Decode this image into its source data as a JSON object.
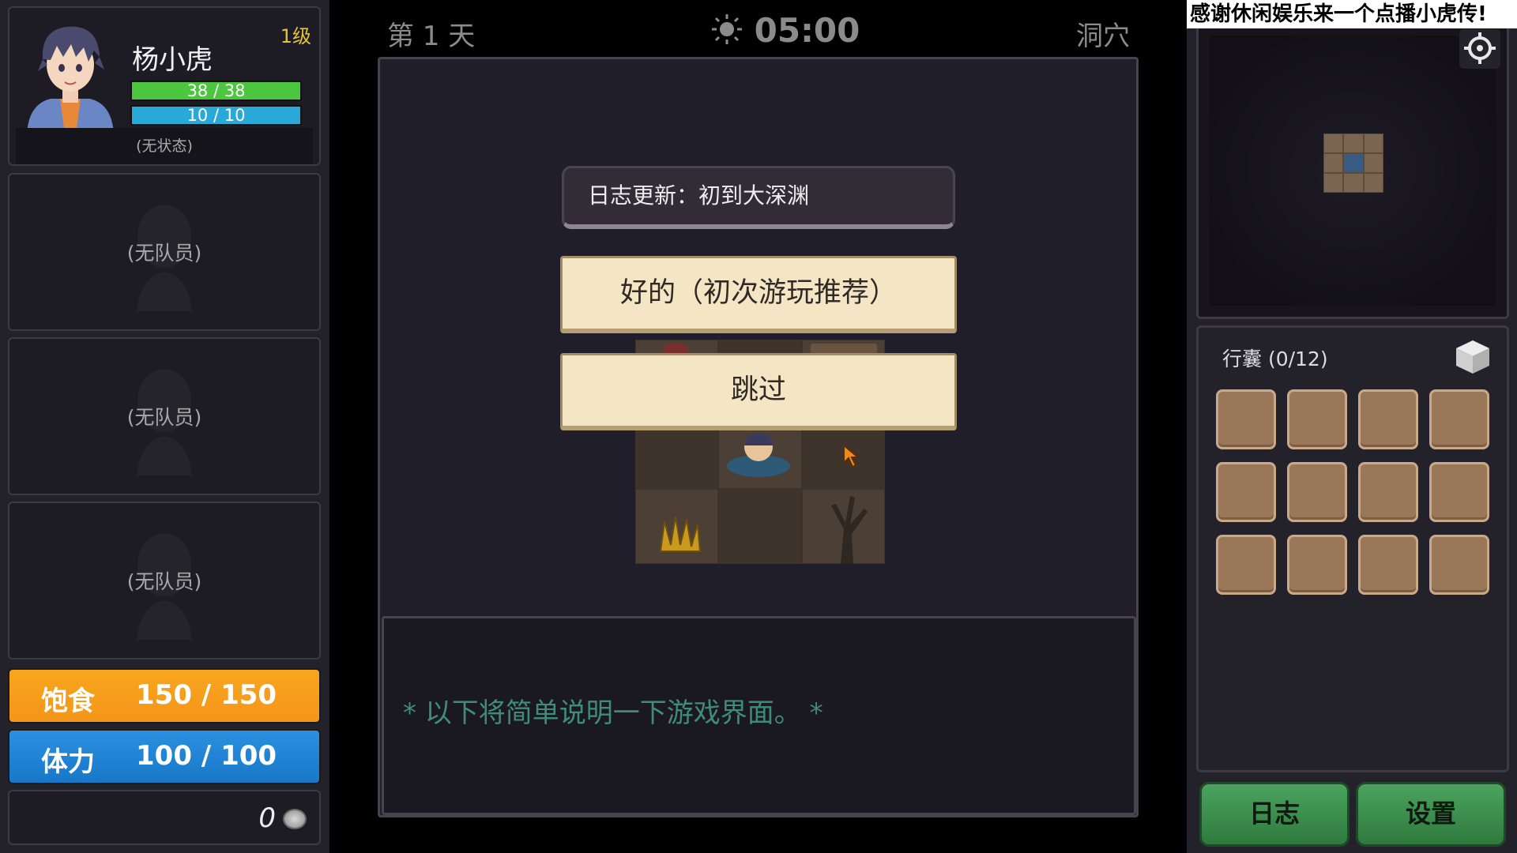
{
  "hero": {
    "name": "杨小虎",
    "level": "1级",
    "hp": "38 / 38",
    "mp": "10 / 10",
    "status": "(无状态)"
  },
  "party": [
    {
      "label": "(无队员)"
    },
    {
      "label": "(无队员)"
    },
    {
      "label": "(无队员)"
    }
  ],
  "stats": {
    "food_label": "饱食",
    "food_value": "150 / 150",
    "stamina_label": "体力",
    "stamina_value": "100 / 100",
    "coins": "0"
  },
  "topbar": {
    "day": "第 1 天",
    "time": "05:00",
    "location": "洞穴"
  },
  "dialog": {
    "title": "日志更新：初到大深渊",
    "ok_button": "好的（初次游玩推荐）",
    "skip_button": "跳过"
  },
  "log": {
    "message": "* 以下将简单说明一下游戏界面。 *"
  },
  "banner": {
    "text": "感谢休闲娱乐来一个点播小虎传!"
  },
  "inventory": {
    "title": "行囊 (0/12)",
    "slots": 12
  },
  "footer": {
    "log_button": "日志",
    "settings_button": "设置"
  },
  "colors": {
    "hp": "#4cc63f",
    "mp": "#29a9d8",
    "food": "#f4951a",
    "stamina": "#1778c8",
    "button_green": "#3a8a4a",
    "dialog_button": "#f4e6c4"
  }
}
